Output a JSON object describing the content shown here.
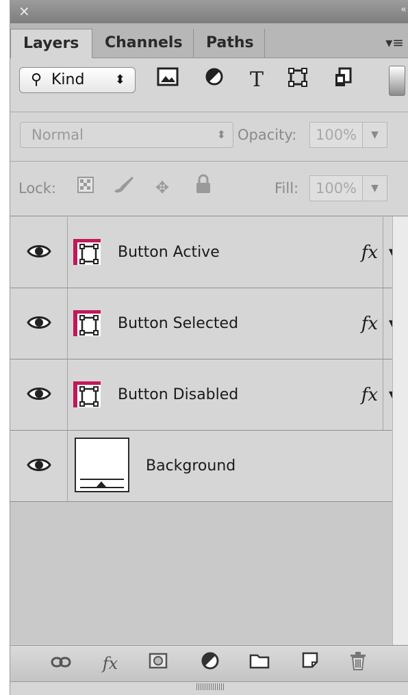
{
  "panel": {
    "close_glyph": "×",
    "collapse_glyph": "«",
    "menu_glyph": "▾≡"
  },
  "tabs": [
    {
      "label": "Layers",
      "active": true
    },
    {
      "label": "Channels",
      "active": false
    },
    {
      "label": "Paths",
      "active": false
    }
  ],
  "filter": {
    "kind_label": "Kind",
    "icons": [
      "image-filter-icon",
      "adjustment-filter-icon",
      "type-filter-icon",
      "shape-filter-icon",
      "smart-object-filter-icon"
    ]
  },
  "blend": {
    "mode": "Normal",
    "opacity_label": "Opacity:",
    "opacity_value": "100%"
  },
  "lock": {
    "label": "Lock:",
    "fill_label": "Fill:",
    "fill_value": "100%"
  },
  "layers": [
    {
      "name": "Button Active",
      "fx": "fx",
      "visible": true,
      "kind": "shape"
    },
    {
      "name": "Button Selected",
      "fx": "fx",
      "visible": true,
      "kind": "shape"
    },
    {
      "name": "Button Disabled",
      "fx": "fx",
      "visible": true,
      "kind": "shape"
    },
    {
      "name": "Background",
      "fx": "",
      "visible": true,
      "kind": "background"
    }
  ],
  "bottom_icons": [
    "link-layers-icon",
    "layer-style-icon",
    "add-mask-icon",
    "new-adjustment-layer-icon",
    "new-group-icon",
    "new-layer-icon",
    "delete-layer-icon"
  ],
  "colors": {
    "shape_accent": "#c2185b",
    "panel_bg": "#d6d6d6",
    "tab_bar": "#b7b7b7"
  }
}
